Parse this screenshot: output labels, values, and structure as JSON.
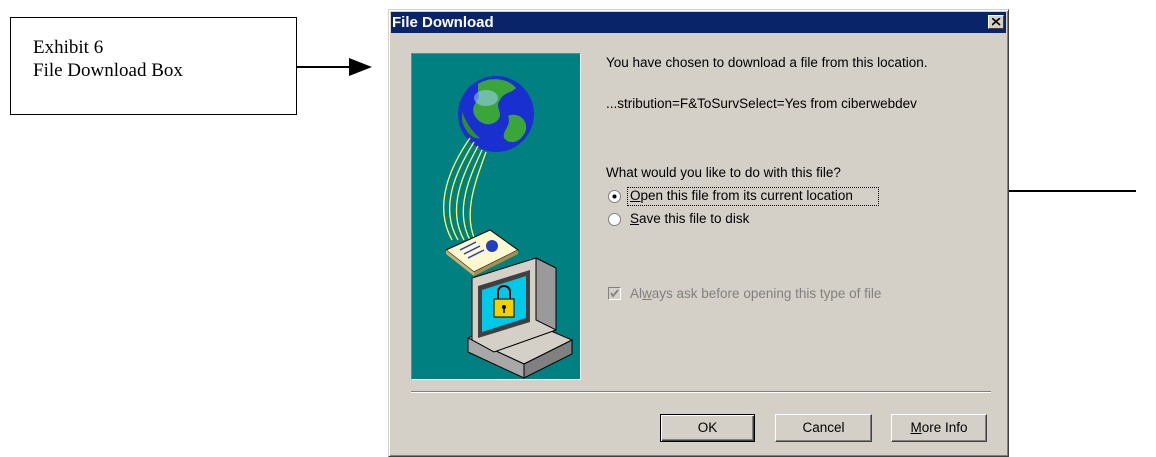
{
  "annotation": {
    "exhibit_line1": "Exhibit 6",
    "exhibit_line2": "File Download Box"
  },
  "dialog": {
    "title": "File Download",
    "close_icon": "close-x-icon",
    "message": "You have chosen to download a file from this location.",
    "location": "...stribution=F&ToSurvSelect=Yes from ciberwebdev",
    "question": "What would you like to do with this file?",
    "options": [
      {
        "mnemonic": "O",
        "rest": "pen this file from its current location",
        "selected": true
      },
      {
        "mnemonic": "S",
        "rest": "ave this file to disk",
        "selected": false
      }
    ],
    "always_ask": {
      "before": "Al",
      "mnemonic": "w",
      "after": "ays ask before opening this type of file",
      "checked": true,
      "enabled": false
    },
    "buttons": {
      "ok": "OK",
      "cancel": "Cancel",
      "more_info_mnemonic": "M",
      "more_info_rest": "ore Info"
    },
    "illustration_icons": [
      "globe-icon",
      "document-icon",
      "computer-icon",
      "padlock-icon"
    ]
  },
  "colors": {
    "titlebar": "#0a246a",
    "dialog_face": "#d4d0c8",
    "illustration_bg": "#008080"
  }
}
